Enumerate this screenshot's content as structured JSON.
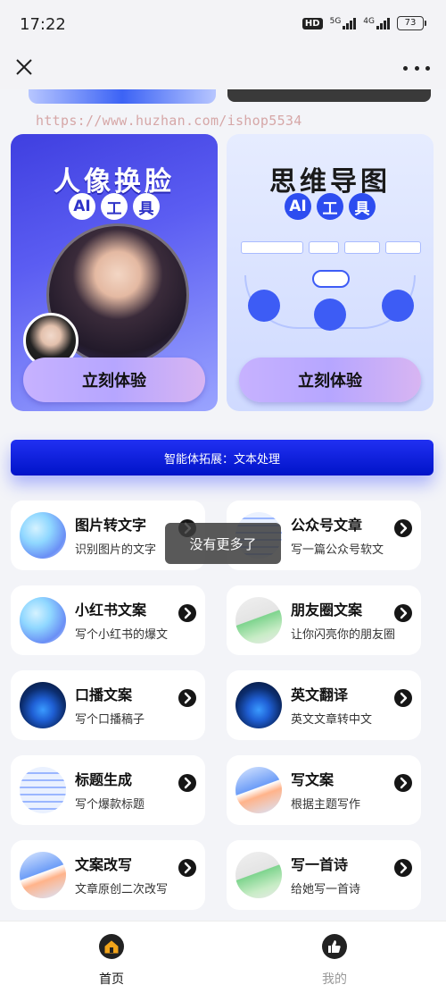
{
  "status_bar": {
    "time": "17:22",
    "hd": "HD",
    "sim1": "5G",
    "sim2": "4G",
    "battery": "73"
  },
  "nav": {
    "close_icon": "close-icon",
    "more_icon": "more-icon"
  },
  "watermark": "https://www.huzhan.com/ishop5534",
  "banners": [
    {
      "title": "人像换脸",
      "tags": [
        "AI",
        "工",
        "具"
      ],
      "button": "立刻体验"
    },
    {
      "title": "思维导图",
      "tags": [
        "AI",
        "工",
        "具"
      ],
      "button": "立刻体验"
    }
  ],
  "section_title": "智能体拓展：文本处理",
  "tools": [
    {
      "title": "图片转文字",
      "desc": "识别图片的文字",
      "icon": "cube-icon"
    },
    {
      "title": "公众号文章",
      "desc": "写一篇公众号软文",
      "icon": "notes-icon"
    },
    {
      "title": "小红书文案",
      "desc": "写个小红书的爆文",
      "icon": "cube-icon"
    },
    {
      "title": "朋友圈文案",
      "desc": "让你闪亮你的朋友圈",
      "icon": "paper-icon"
    },
    {
      "title": "口播文案",
      "desc": "写个口播稿子",
      "icon": "screen-icon"
    },
    {
      "title": "英文翻译",
      "desc": "英文文章转中文",
      "icon": "screen-icon"
    },
    {
      "title": "标题生成",
      "desc": "写个爆款标题",
      "icon": "list-icon"
    },
    {
      "title": "写文案",
      "desc": "根据主题写作",
      "icon": "doc-icon"
    },
    {
      "title": "文案改写",
      "desc": "文章原创二次改写",
      "icon": "doc-icon"
    },
    {
      "title": "写一首诗",
      "desc": "给她写一首诗",
      "icon": "paper-icon"
    }
  ],
  "toast": "没有更多了",
  "tabbar": {
    "home": "首页",
    "mine": "我的"
  },
  "colors": {
    "accent": "#0a1ad6",
    "background": "#f3f4f8"
  }
}
